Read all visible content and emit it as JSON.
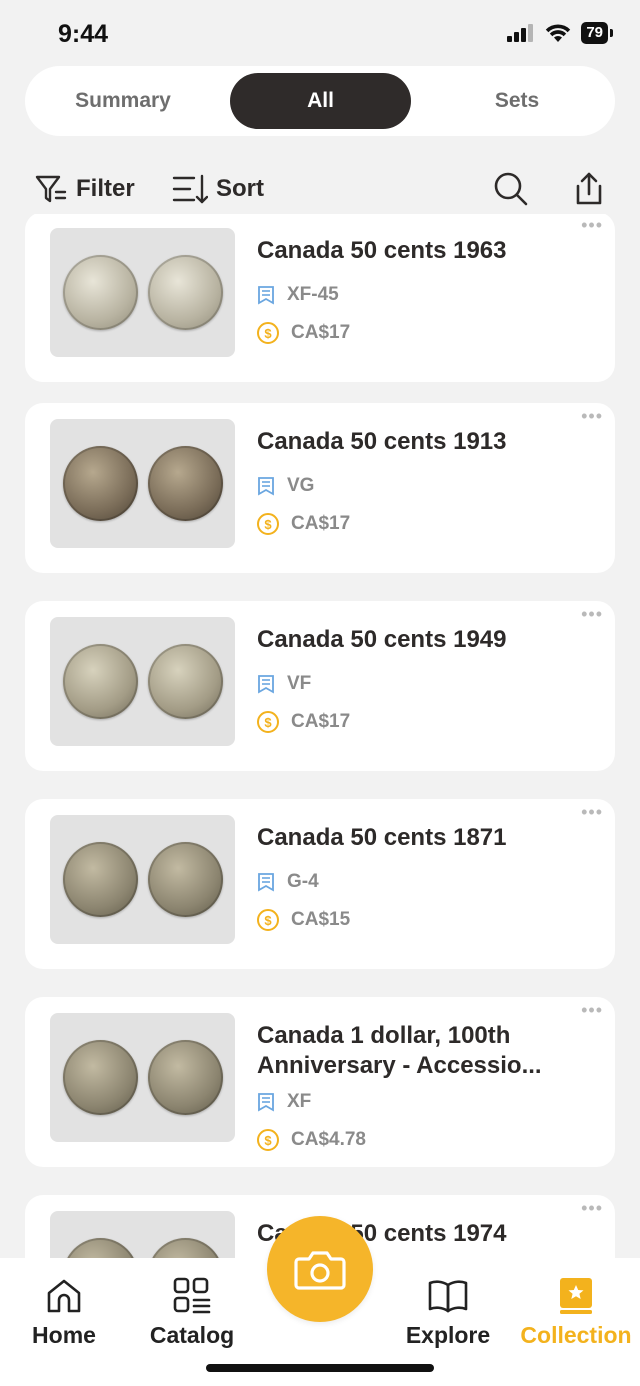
{
  "status": {
    "time": "9:44",
    "battery": "79"
  },
  "tabs": {
    "summary": "Summary",
    "all": "All",
    "sets": "Sets"
  },
  "toolbar": {
    "filter": "Filter",
    "sort": "Sort"
  },
  "items": [
    {
      "title": "Canada 50 cents 1963",
      "grade": "XF-45",
      "value": "CA$17"
    },
    {
      "title": "Canada 50 cents 1913",
      "grade": "VG",
      "value": "CA$17"
    },
    {
      "title": "Canada 50 cents 1949",
      "grade": "VF",
      "value": "CA$17"
    },
    {
      "title": "Canada 50 cents 1871",
      "grade": "G-4",
      "value": "CA$15"
    },
    {
      "title": "Canada 1 dollar, 100th Anniversary - Accessio...",
      "grade": "XF",
      "value": "CA$4.78"
    },
    {
      "title": "Canada 50 cents 1974",
      "grade": "",
      "value": ""
    }
  ],
  "nav": {
    "home": "Home",
    "catalog": "Catalog",
    "explore": "Explore",
    "collection": "Collection"
  },
  "colors": {
    "accent": "#f3b21d",
    "segment_active": "#2f2b2a",
    "grade_icon": "#6aa6e0"
  }
}
